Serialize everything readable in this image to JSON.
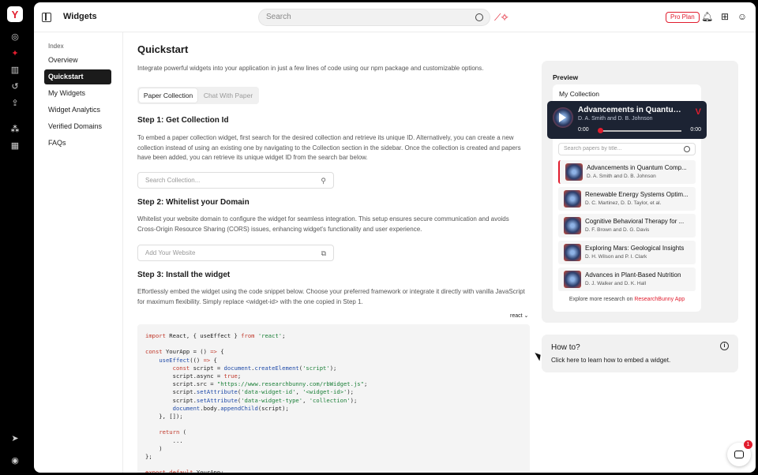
{
  "app": {
    "logo": "Y"
  },
  "rail": {
    "icons": [
      "compass-icon",
      "sparkle-icon",
      "library-icon",
      "history-icon",
      "upload-icon",
      "widgets-icon",
      "grid-icon",
      "send-icon",
      "user-icon"
    ]
  },
  "header": {
    "title": "Widgets",
    "search_placeholder": "Search",
    "pro_label": "Pro Plan"
  },
  "index_nav": {
    "label": "Index",
    "items": [
      "Overview",
      "Quickstart",
      "My Widgets",
      "Widget Analytics",
      "Verified Domains",
      "FAQs"
    ],
    "active": "Quickstart"
  },
  "main": {
    "title": "Quickstart",
    "intro": "Integrate powerful widgets into your application in just a few lines of code using our npm package and customizable options.",
    "tabs": [
      "Paper Collection",
      "Chat With Paper"
    ],
    "step1": {
      "title": "Step 1: Get Collection Id",
      "text": "To embed a paper collection widget, first search for the desired collection and retrieve its unique ID. Alternatively, you can create a new collection instead of using an existing one by navigating to the Collection section in the sidebar. Once the collection is created and papers have been added, you can retrieve its unique widget ID from the search bar below.",
      "placeholder": "Search Collection..."
    },
    "step2": {
      "title": "Step 2: Whitelist your Domain",
      "text": "Whitelist your website domain to configure the widget for seamless integration. This setup ensures secure communication and avoids Cross-Origin Resource Sharing (CORS) issues, enhancing widget's functionality and user experience.",
      "placeholder": "Add Your Website"
    },
    "step3": {
      "title": "Step 3: Install the widget",
      "text": "Effortlessly embed the widget using the code snippet below. Choose your preferred framework or integrate it directly with vanilla JavaScript for maximum flexibility. Simply replace <widget-id> with the one copied in Step 1."
    },
    "framework": "react"
  },
  "preview": {
    "label": "Preview",
    "collection_title": "My Collection",
    "player": {
      "title": "Advancements in Quantum...",
      "authors": "D. A. Smith and D. B. Johnson",
      "time_start": "0:00",
      "time_end": "0:00",
      "progress": 0.0
    },
    "search_placeholder": "Search papers by title...",
    "papers": [
      {
        "title": "Advancements in Quantum Comp...",
        "authors": "D. A. Smith and D. B. Johnson"
      },
      {
        "title": "Renewable Energy Systems Optim...",
        "authors": "D. C. Martinez, D. D. Taylor, et al."
      },
      {
        "title": "Cognitive Behavioral Therapy for ...",
        "authors": "D. F. Brown and D. G. Davis"
      },
      {
        "title": "Exploring Mars: Geological Insights",
        "authors": "D. H. Wilson and P. I. Clark"
      },
      {
        "title": "Advances in Plant-Based Nutrition",
        "authors": "D. J. Walker and D. K. Hall"
      }
    ],
    "explore_text": "Explore more research on ",
    "explore_link": "ResearchBunny App"
  },
  "howto": {
    "title": "How to?",
    "subtitle": "Click here to learn how to embed a widget."
  },
  "chat": {
    "badge": "1"
  },
  "colors": {
    "accent": "#e11d2e",
    "player_bg": "#1c2333"
  }
}
